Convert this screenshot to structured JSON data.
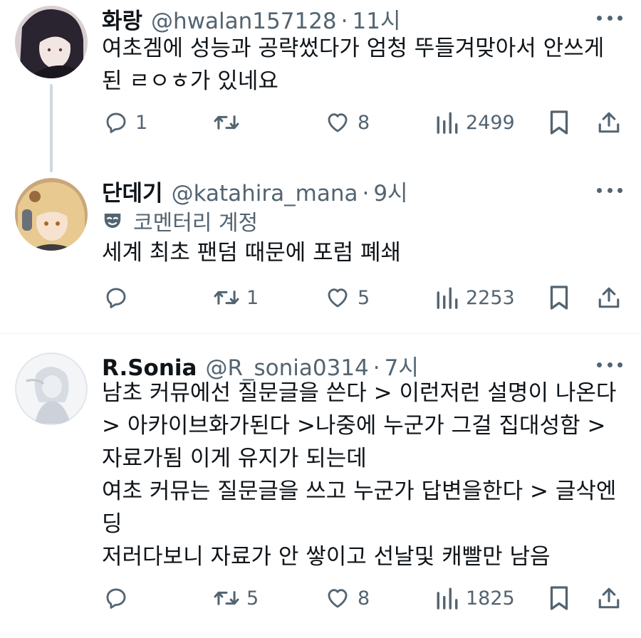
{
  "tweets": [
    {
      "name": "화랑",
      "handle": "@hwalan157128",
      "time": "11시",
      "lines": [
        "여초겜에 성능과 공략썼다가 엄청 뚜들겨맞아서 안쓰게",
        "된 ㄹㅇㅎ가 있네요"
      ],
      "replies": "1",
      "retweets": "",
      "likes": "8",
      "views": "2499"
    },
    {
      "name": "단데기",
      "handle": "@katahira_mana",
      "time": "9시",
      "badge": "코멘터리 계정",
      "lines": [
        "세계 최초 팬덤 때문에 포럼 폐쇄"
      ],
      "replies": "",
      "retweets": "1",
      "likes": "5",
      "views": "2253"
    },
    {
      "name": "R.Sonia",
      "handle": "@R_sonia0314",
      "time": "7시",
      "lines": [
        "남초 커뮤에선 질문글을 쓴다 > 이런저런 설명이 나온다",
        "> 아카이브화가된다 >나중에 누군가 그걸 집대성함 >",
        "자료가됨 이게 유지가 되는데",
        "여초 커뮤는 질문글을 쓰고 누군가 답변을한다 > 글삭엔",
        "딩",
        "저러다보니 자료가 안 쌓이고 선날및 캐빨만 남음"
      ],
      "replies": "",
      "retweets": "5",
      "likes": "8",
      "views": "1825"
    }
  ],
  "separator_dot": "·",
  "colors": {
    "text": "#0f1419",
    "muted": "#536471",
    "line": "#cfd9de",
    "divider": "#eff3f4"
  },
  "icons": [
    "more-icon",
    "reply-icon",
    "retweet-icon",
    "like-icon",
    "views-icon",
    "bookmark-icon",
    "share-icon",
    "mask-icon"
  ]
}
